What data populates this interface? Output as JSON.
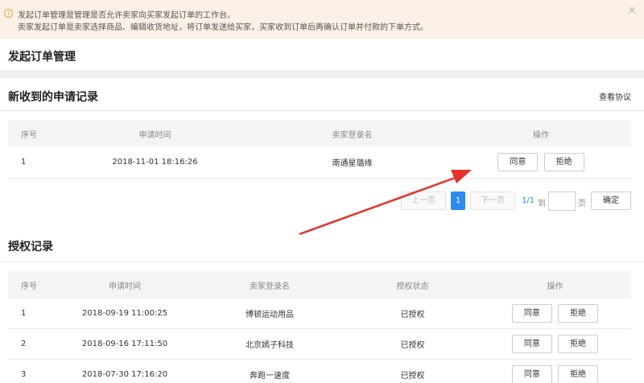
{
  "notice": {
    "line1": "发起订单管理是管理是否允许卖家向买家发起订单的工作台。",
    "line2": "卖家发起订单是卖家选择商品、编辑收货地址，将订单发送给买家，买家收到订单后再确认订单并付款的下单方式。",
    "close": "×",
    "info_icon": "i"
  },
  "page_title": "发起订单管理",
  "requests": {
    "title": "新收到的申请记录",
    "view_link": "查看协议",
    "columns": [
      "序号",
      "申请时间",
      "卖家登录名",
      "操作"
    ],
    "rows": [
      {
        "idx": "1",
        "time": "2018-11-01 18:16:26",
        "seller": "南通星璐缘",
        "agree": "同意",
        "reject": "拒绝"
      }
    ],
    "pager": {
      "prev": "上一页",
      "current": "1",
      "next": "下一页",
      "count": "1/1",
      "to": "到",
      "page": "页",
      "confirm": "确定"
    }
  },
  "auth": {
    "title": "授权记录",
    "columns": [
      "序号",
      "申请时间",
      "卖家登录名",
      "授权状态",
      "操作"
    ],
    "rows": [
      {
        "idx": "1",
        "time": "2018-09-19 11:00:25",
        "seller": "博顿运动用品",
        "status": "已授权",
        "agree": "同意",
        "reject": "拒绝"
      },
      {
        "idx": "2",
        "time": "2018-09-16 17:11:50",
        "seller": "北京嫣子科技",
        "status": "已授权",
        "agree": "同意",
        "reject": "拒绝"
      },
      {
        "idx": "3",
        "time": "2018-07-30 17:16:20",
        "seller": "奔跑一速度",
        "status": "已授权",
        "agree": "同意",
        "reject": "拒绝"
      }
    ]
  },
  "colors": {
    "accent": "#2d8cf0",
    "notice_bg": "#fdf1e7",
    "arrow": "#e5322d"
  }
}
